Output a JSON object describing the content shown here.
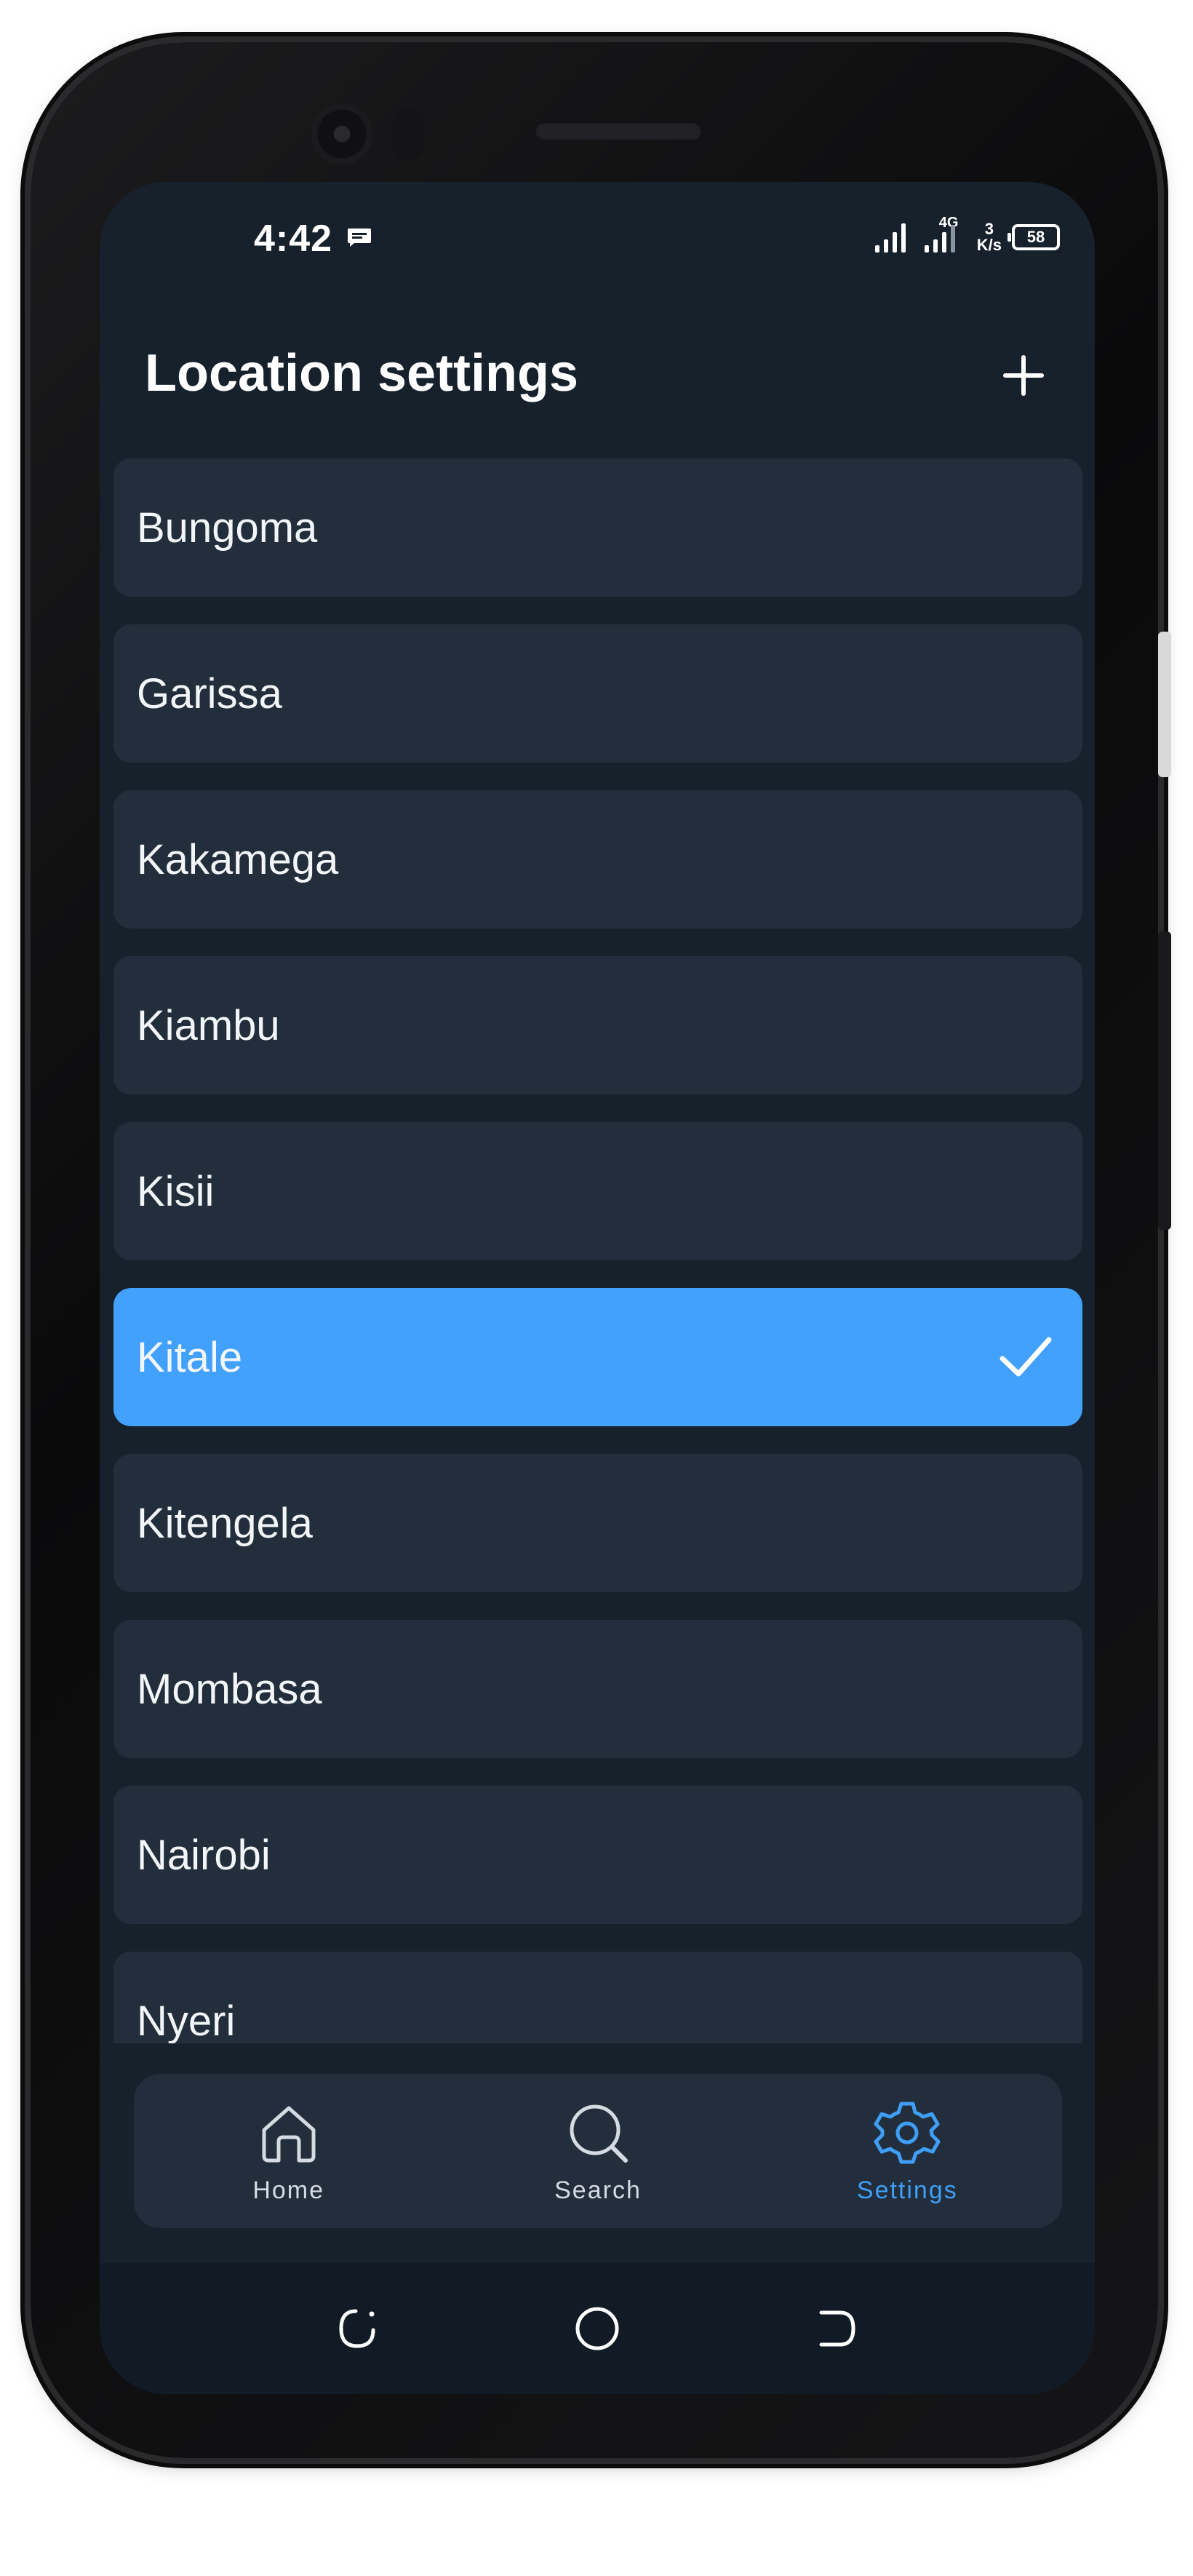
{
  "status_bar": {
    "time": "4:42",
    "network_type": "4G",
    "speed_value": "3",
    "speed_unit": "K/s",
    "battery": "58",
    "icons": [
      "message-icon",
      "signal-icon",
      "signal-4g-icon",
      "battery-icon"
    ]
  },
  "header": {
    "title": "Location settings",
    "add_icon": "plus-icon"
  },
  "locations": {
    "selected": "Kitale",
    "items": [
      {
        "name": "Bungoma",
        "selected": false
      },
      {
        "name": "Garissa",
        "selected": false
      },
      {
        "name": "Kakamega",
        "selected": false
      },
      {
        "name": "Kiambu",
        "selected": false
      },
      {
        "name": "Kisii",
        "selected": false
      },
      {
        "name": "Kitale",
        "selected": true
      },
      {
        "name": "Kitengela",
        "selected": false
      },
      {
        "name": "Mombasa",
        "selected": false
      },
      {
        "name": "Nairobi",
        "selected": false
      },
      {
        "name": "Nyeri",
        "selected": false
      }
    ]
  },
  "bottom_nav": {
    "items": [
      {
        "label": "Home",
        "icon": "home-icon",
        "active": false
      },
      {
        "label": "Search",
        "icon": "search-icon",
        "active": false
      },
      {
        "label": "Settings",
        "icon": "gear-icon",
        "active": true
      }
    ]
  },
  "system_nav": {
    "icons": [
      "recents-icon",
      "home-circle-icon",
      "back-icon"
    ]
  },
  "colors": {
    "background": "#17212c",
    "card": "#222e3b",
    "accent": "#42a1fc",
    "active_nav": "#3f9ef5",
    "text": "#ffffff"
  }
}
